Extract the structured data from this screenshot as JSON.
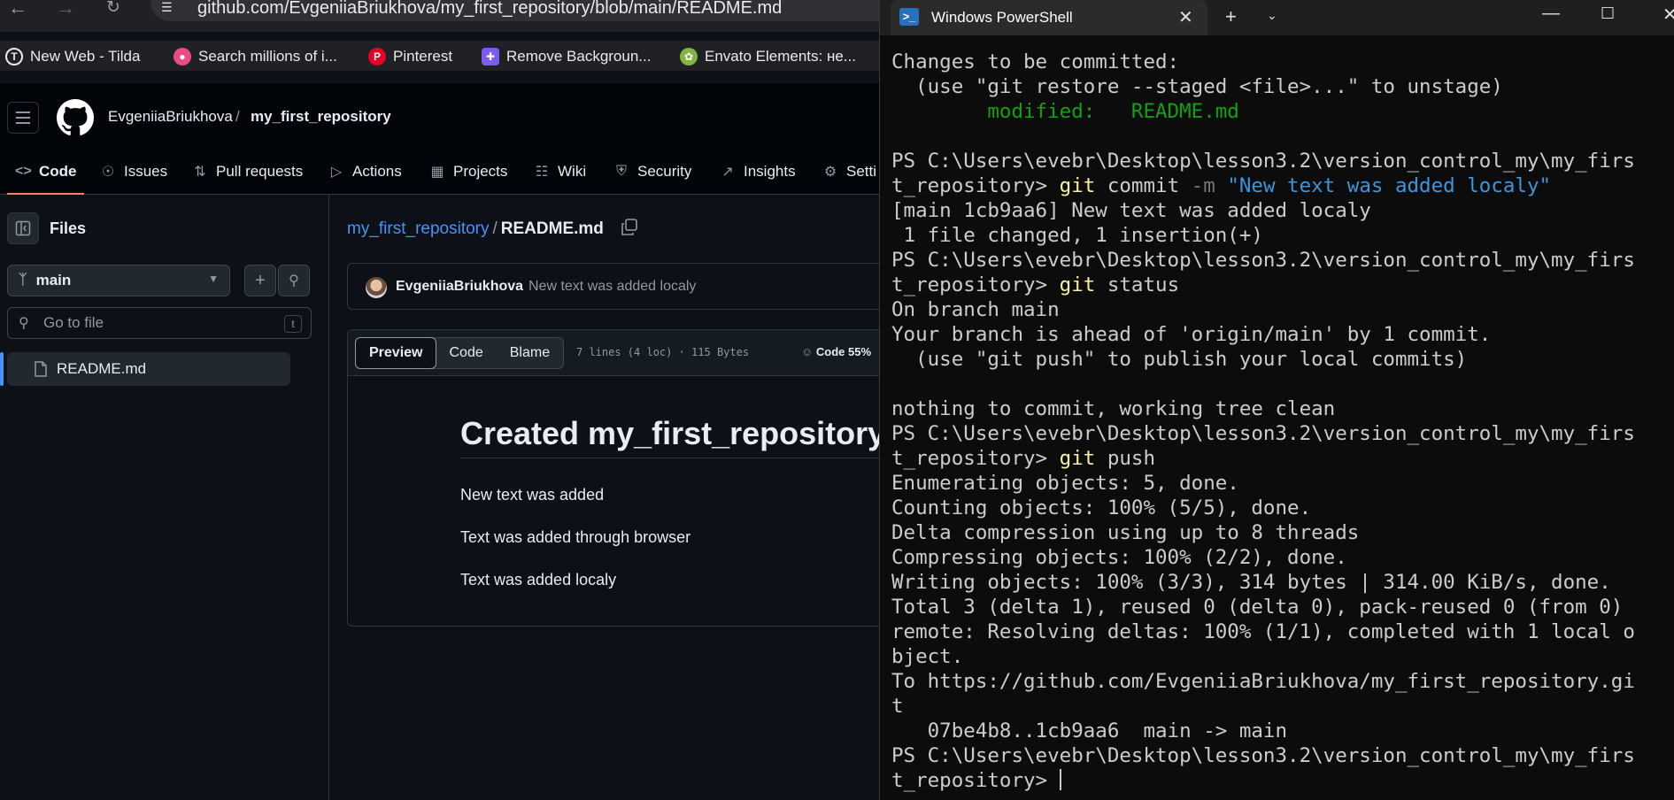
{
  "browser": {
    "url": "github.com/EvgeniiaBriukhova/my_first_repository/blob/main/README.md",
    "bookmarks": [
      {
        "label": "New Web - Tilda",
        "icon": "tilda-icon",
        "color": "#ffffff"
      },
      {
        "label": "Search millions of i...",
        "icon": "dribbble-icon",
        "color": "#ea4c89"
      },
      {
        "label": "Pinterest",
        "icon": "pinterest-icon",
        "color": "#e60023"
      },
      {
        "label": "Remove Backgroun...",
        "icon": "removebg-icon",
        "color": "#7b5cf0"
      },
      {
        "label": "Envato Elements: не...",
        "icon": "envato-icon",
        "color": "#82b541"
      }
    ]
  },
  "github": {
    "owner": "EvgeniiaBriukhova",
    "separator": "/",
    "repo": "my_first_repository",
    "tabs": [
      {
        "label": "Code",
        "icon": "code-icon"
      },
      {
        "label": "Issues",
        "icon": "issue-icon"
      },
      {
        "label": "Pull requests",
        "icon": "pull-request-icon"
      },
      {
        "label": "Actions",
        "icon": "play-icon"
      },
      {
        "label": "Projects",
        "icon": "table-icon"
      },
      {
        "label": "Wiki",
        "icon": "book-icon"
      },
      {
        "label": "Security",
        "icon": "shield-icon"
      },
      {
        "label": "Insights",
        "icon": "graph-icon"
      },
      {
        "label": "Setti",
        "icon": "gear-icon"
      }
    ],
    "accent": "#4493f8",
    "tab_underline": "#f78166"
  },
  "sidebar": {
    "title": "Files",
    "branch": "main",
    "goto_placeholder": "Go to file",
    "goto_kbd": "t",
    "files": [
      "README.md"
    ]
  },
  "main": {
    "crumb_repo": "my_first_repository",
    "crumb_sep": "/",
    "crumb_file": "README.md",
    "commit_author": "EvgeniiaBriukhova",
    "commit_message": "New text was added localy",
    "view_tabs": [
      "Preview",
      "Code",
      "Blame"
    ],
    "file_meta": "7 lines (4 loc) · 115 Bytes",
    "language_stat": "Code 55%",
    "readme": {
      "heading": "Created my_first_repository",
      "paragraphs": [
        "New text was added",
        "Text was added through browser",
        "Text was added localy"
      ]
    }
  },
  "powershell": {
    "tab_title": "Windows PowerShell",
    "lines": [
      [
        {
          "t": "Changes to be committed:"
        }
      ],
      [
        {
          "t": "  (use \"git restore --staged <file>...\" to unstage)"
        }
      ],
      [
        {
          "t": "        modified:   README.md",
          "c": "g"
        }
      ],
      [
        {
          "t": ""
        }
      ],
      [
        {
          "t": "PS C:\\Users\\evebr\\Desktop\\lesson3.2\\version_control_my\\my_firs"
        }
      ],
      [
        {
          "t": "t_repository> "
        },
        {
          "t": "git",
          "c": "y"
        },
        {
          "t": " commit "
        },
        {
          "t": "-m",
          "c": "gr"
        },
        {
          "t": " "
        },
        {
          "t": "\"New text was added localy\"",
          "c": "b"
        }
      ],
      [
        {
          "t": "[main 1cb9aa6] New text was added localy"
        }
      ],
      [
        {
          "t": " 1 file changed, 1 insertion(+)"
        }
      ],
      [
        {
          "t": "PS C:\\Users\\evebr\\Desktop\\lesson3.2\\version_control_my\\my_firs"
        }
      ],
      [
        {
          "t": "t_repository> "
        },
        {
          "t": "git",
          "c": "y"
        },
        {
          "t": " status"
        }
      ],
      [
        {
          "t": "On branch main"
        }
      ],
      [
        {
          "t": "Your branch is ahead of 'origin/main' by 1 commit."
        }
      ],
      [
        {
          "t": "  (use \"git push\" to publish your local commits)"
        }
      ],
      [
        {
          "t": ""
        }
      ],
      [
        {
          "t": "nothing to commit, working tree clean"
        }
      ],
      [
        {
          "t": "PS C:\\Users\\evebr\\Desktop\\lesson3.2\\version_control_my\\my_firs"
        }
      ],
      [
        {
          "t": "t_repository> "
        },
        {
          "t": "git",
          "c": "y"
        },
        {
          "t": " push"
        }
      ],
      [
        {
          "t": "Enumerating objects: 5, done."
        }
      ],
      [
        {
          "t": "Counting objects: 100% (5/5), done."
        }
      ],
      [
        {
          "t": "Delta compression using up to 8 threads"
        }
      ],
      [
        {
          "t": "Compressing objects: 100% (2/2), done."
        }
      ],
      [
        {
          "t": "Writing objects: 100% (3/3), 314 bytes | 314.00 KiB/s, done."
        }
      ],
      [
        {
          "t": "Total 3 (delta 1), reused 0 (delta 0), pack-reused 0 (from 0)"
        }
      ],
      [
        {
          "t": "remote: Resolving deltas: 100% (1/1), completed with 1 local o"
        }
      ],
      [
        {
          "t": "bject."
        }
      ],
      [
        {
          "t": "To https://github.com/EvgeniiaBriukhova/my_first_repository.gi"
        }
      ],
      [
        {
          "t": "t"
        }
      ],
      [
        {
          "t": "   07be4b8..1cb9aa6  main -> main"
        }
      ],
      [
        {
          "t": "PS C:\\Users\\evebr\\Desktop\\lesson3.2\\version_control_my\\my_firs"
        }
      ],
      [
        {
          "t": "t_repository> "
        },
        {
          "cursor": true
        }
      ]
    ]
  }
}
